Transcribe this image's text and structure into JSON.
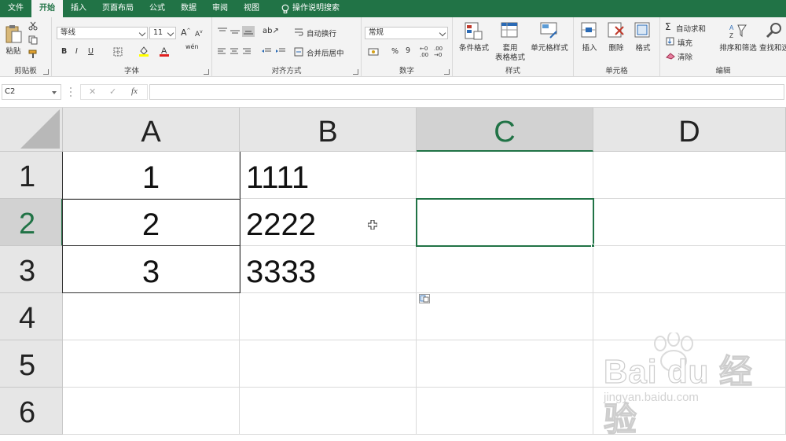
{
  "tabs": [
    {
      "label": "文件",
      "active": false
    },
    {
      "label": "开始",
      "active": true
    },
    {
      "label": "插入",
      "active": false
    },
    {
      "label": "页面布局",
      "active": false
    },
    {
      "label": "公式",
      "active": false
    },
    {
      "label": "数据",
      "active": false
    },
    {
      "label": "审阅",
      "active": false
    },
    {
      "label": "视图",
      "active": false
    }
  ],
  "tell_me": "操作说明搜索",
  "ribbon": {
    "clipboard": {
      "paste": "粘贴",
      "group": "剪贴板"
    },
    "font": {
      "name": "等线",
      "size": "11",
      "group": "字体",
      "bold": "B",
      "italic": "I",
      "underline": "U",
      "wen": "wén"
    },
    "alignment": {
      "wrap": "自动换行",
      "merge": "合并后居中",
      "group": "对齐方式"
    },
    "number": {
      "format": "常规",
      "percent": "%",
      "comma": "9",
      "group": "数字"
    },
    "styles": {
      "conditional": "条件格式",
      "table1": "套用",
      "table2": "表格格式",
      "cell_styles": "单元格样式",
      "group": "样式"
    },
    "cells": {
      "insert": "插入",
      "delete": "删除",
      "format": "格式",
      "group": "单元格"
    },
    "editing": {
      "autosum": "自动求和",
      "fill": "填充",
      "clear": "清除",
      "sort": "排序和筛选",
      "find": "查找和选",
      "group": "编辑"
    }
  },
  "formula_bar": {
    "name_box": "C2",
    "fx": "fx",
    "value": ""
  },
  "columns": [
    "A",
    "B",
    "C",
    "D"
  ],
  "selected_column": "C",
  "rows": [
    "1",
    "2",
    "3",
    "4",
    "5",
    "6"
  ],
  "selected_row": "2",
  "cells": {
    "A1": "1",
    "A2": "2",
    "A3": "3",
    "B1": "1111",
    "B2": "2222",
    "B3": "3333"
  },
  "active_cell": "C2",
  "watermark": {
    "main": "Bai du 经验",
    "sub": "jingyan.baidu.com"
  },
  "colors": {
    "accent": "#217346",
    "header_bg": "#e6e6e6",
    "selected_header_bg": "#d2d2d2"
  }
}
